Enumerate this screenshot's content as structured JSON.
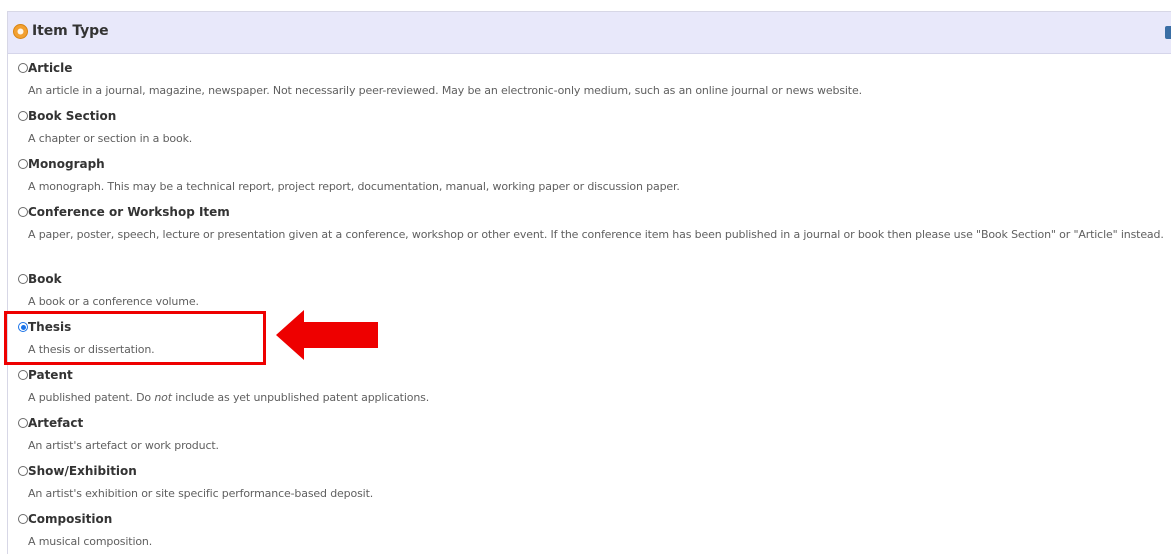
{
  "panel": {
    "title": "Item Type",
    "header_icon": "orange-circle-icon",
    "help_icon": "help-icon"
  },
  "item_types": [
    {
      "label": "Article",
      "description": "An article in a journal, magazine, newspaper. Not necessarily peer-reviewed. May be an electronic-only medium, such as an online journal or news website.",
      "selected": false
    },
    {
      "label": "Book Section",
      "description": "A chapter or section in a book.",
      "selected": false
    },
    {
      "label": "Monograph",
      "description": "A monograph. This may be a technical report, project report, documentation, manual, working paper or discussion paper.",
      "selected": false
    },
    {
      "label": "Conference or Workshop Item",
      "description": "A paper, poster, speech, lecture or presentation given at a conference, workshop or other event. If the conference item has been published in a journal or book then please use \"Book Section\" or \"Article\" instead.",
      "selected": false
    },
    {
      "label": "Book",
      "description": "A book or a conference volume.",
      "selected": false
    },
    {
      "label": "Thesis",
      "description": "A thesis or dissertation.",
      "selected": true
    },
    {
      "label": "Patent",
      "description_parts": [
        "A published patent. Do ",
        "not",
        " include as yet unpublished patent applications."
      ],
      "selected": false
    },
    {
      "label": "Artefact",
      "description": "An artist's artefact or work product.",
      "selected": false
    },
    {
      "label": "Show/Exhibition",
      "description": "An artist's exhibition or site specific performance-based deposit.",
      "selected": false
    },
    {
      "label": "Composition",
      "description": "A musical composition.",
      "selected": false
    }
  ],
  "annotation": {
    "highlight_color": "#ee0000",
    "header_bg": "#e8e8fa",
    "accent": "#1a73e8"
  }
}
